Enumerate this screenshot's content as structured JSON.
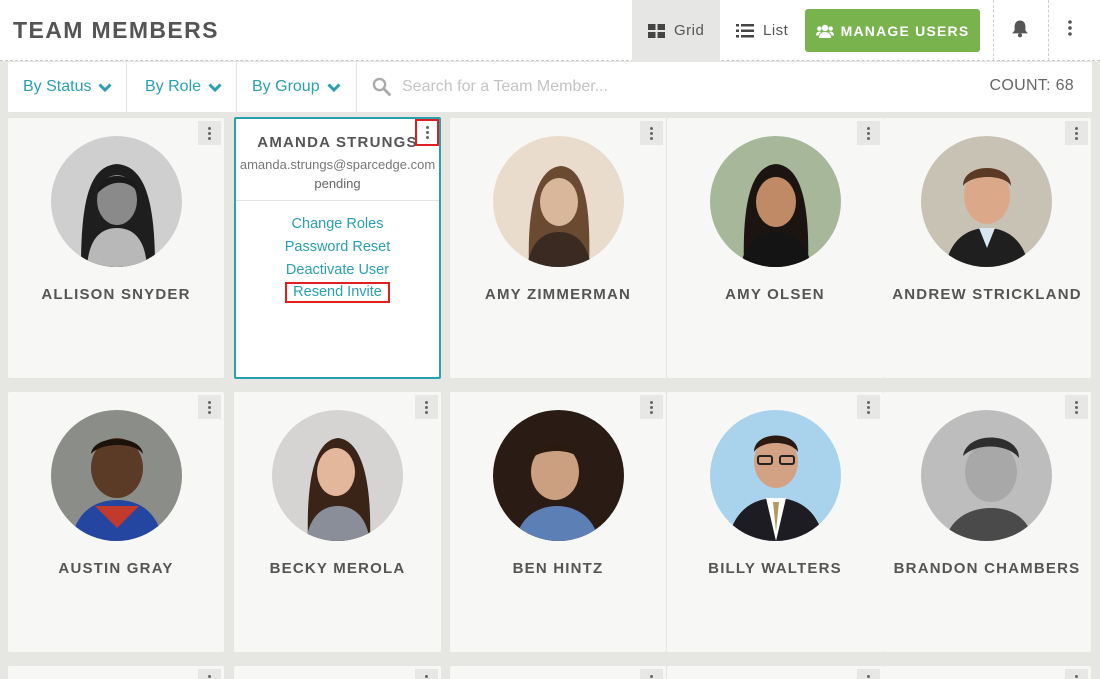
{
  "header": {
    "title": "TEAM MEMBERS",
    "view_grid_label": "Grid",
    "view_list_label": "List",
    "manage_users_label": "MANAGE USERS"
  },
  "filters": {
    "status_label": "By Status",
    "role_label": "By Role",
    "group_label": "By Group",
    "search_placeholder": "Search for a Team Member...",
    "count_text": "COUNT: 68"
  },
  "selected_member": {
    "name": "AMANDA STRUNGS",
    "email": "amanda.strungs@sparcedge.com",
    "status": "pending",
    "menu": [
      "Change Roles",
      "Password Reset",
      "Deactivate User",
      "Resend Invite"
    ]
  },
  "members": [
    {
      "name": "ALLISON SNYDER"
    },
    {
      "name": "AMY ZIMMERMAN"
    },
    {
      "name": "AMY OLSEN"
    },
    {
      "name": "ANDREW STRICKLAND"
    },
    {
      "name": "AUSTIN GRAY"
    },
    {
      "name": "BECKY MEROLA"
    },
    {
      "name": "BEN HINTZ"
    },
    {
      "name": "BILLY WALTERS"
    },
    {
      "name": "BRANDON CHAMBERS"
    }
  ],
  "colors": {
    "accent": "#2a9fb0",
    "manage_button": "#78b34e",
    "highlight_outline": "#e02020",
    "page_background": "#e6e6e3"
  },
  "icons": [
    "grid-icon",
    "list-icon",
    "users-icon",
    "bell-icon",
    "more-vertical-icon",
    "chevron-down-icon",
    "search-icon"
  ]
}
